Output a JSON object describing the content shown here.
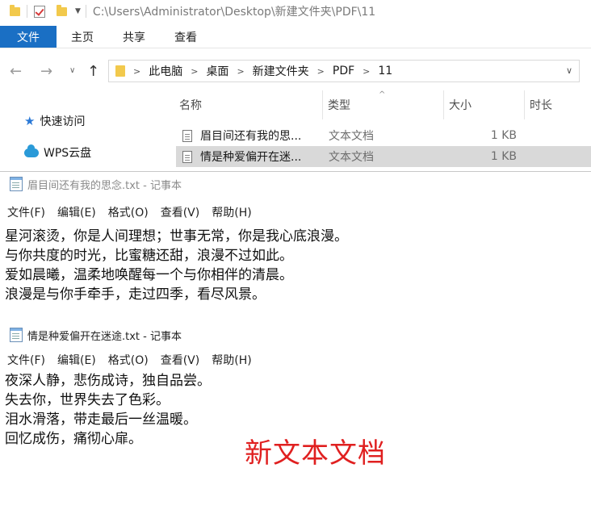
{
  "titlebar": {
    "path": "C:\\Users\\Administrator\\Desktop\\新建文件夹\\PDF\\11"
  },
  "ribbon": {
    "tabs": [
      "文件",
      "主页",
      "共享",
      "查看"
    ]
  },
  "address": {
    "crumbs": [
      "此电脑",
      "桌面",
      "新建文件夹",
      "PDF",
      "11"
    ]
  },
  "navpane": {
    "items": [
      "快速访问",
      "WPS云盘"
    ]
  },
  "filelist": {
    "columns": [
      "名称",
      "类型",
      "大小",
      "时长"
    ],
    "rows": [
      {
        "name": "眉目间还有我的思...",
        "type": "文本文档",
        "size": "1 KB",
        "selected": false
      },
      {
        "name": "情是种爱偏开在迷...",
        "type": "文本文档",
        "size": "1 KB",
        "selected": true
      }
    ]
  },
  "notepad1": {
    "title": "眉目间还有我的思念.txt - 记事本",
    "menu": [
      "文件(F)",
      "编辑(E)",
      "格式(O)",
      "查看(V)",
      "帮助(H)"
    ],
    "lines": [
      "星河滚烫，你是人间理想；世事无常，你是我心底浪漫。",
      "与你共度的时光，比蜜糖还甜，浪漫不过如此。",
      "爱如晨曦，温柔地唤醒每一个与你相伴的清晨。",
      "浪漫是与你手牵手，走过四季，看尽风景。"
    ]
  },
  "notepad2": {
    "title": "情是种爱偏开在迷途.txt - 记事本",
    "menu": [
      "文件(F)",
      "编辑(E)",
      "格式(O)",
      "查看(V)",
      "帮助(H)"
    ],
    "lines": [
      "夜深人静，悲伤成诗，独自品尝。",
      "失去你，世界失去了色彩。",
      "泪水滑落，带走最后一丝温暖。",
      "回忆成伤，痛彻心扉。"
    ]
  },
  "caption": "新文本文档",
  "colors": {
    "accent": "#1a6fc4",
    "selection": "#d9d9d9",
    "caption": "#e02020"
  }
}
